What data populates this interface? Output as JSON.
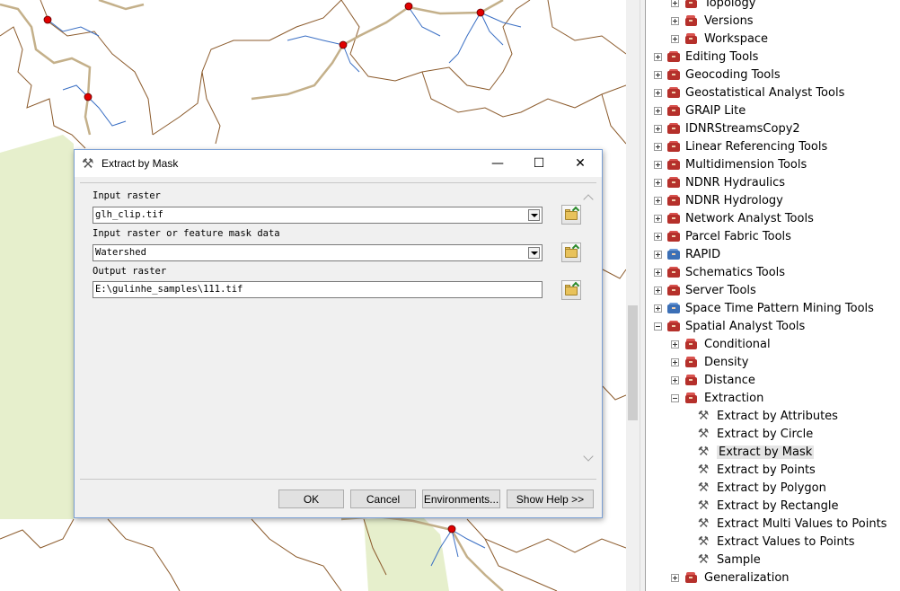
{
  "dialog": {
    "title": "Extract by Mask",
    "title_icon": "hammer-icon",
    "params": [
      {
        "label": "Input raster",
        "value": "glh_clip.tif",
        "type": "dropdown"
      },
      {
        "label": "Input raster or feature mask data",
        "value": "Watershed",
        "type": "dropdown"
      },
      {
        "label": "Output raster",
        "value": "E:\\gulinhe_samples\\111.tif",
        "type": "text"
      }
    ],
    "buttons": {
      "ok": "OK",
      "cancel": "Cancel",
      "environments": "Environments...",
      "show_help": "Show Help >>"
    },
    "window_buttons": {
      "minimize": "—",
      "maximize": "☐",
      "close": "✕"
    }
  },
  "toolbox_tree": {
    "items": [
      {
        "label": "Topology",
        "indent": 1,
        "expander": "plus",
        "icon": "toolset-icon"
      },
      {
        "label": "Versions",
        "indent": 1,
        "expander": "plus",
        "icon": "toolset-icon"
      },
      {
        "label": "Workspace",
        "indent": 1,
        "expander": "plus",
        "icon": "toolset-icon"
      },
      {
        "label": "Editing Tools",
        "indent": 0,
        "expander": "plus",
        "icon": "toolbox-icon"
      },
      {
        "label": "Geocoding Tools",
        "indent": 0,
        "expander": "plus",
        "icon": "toolbox-icon"
      },
      {
        "label": "Geostatistical Analyst Tools",
        "indent": 0,
        "expander": "plus",
        "icon": "toolbox-icon"
      },
      {
        "label": "GRAIP Lite",
        "indent": 0,
        "expander": "plus",
        "icon": "toolbox-icon"
      },
      {
        "label": "IDNRStreamsCopy2",
        "indent": 0,
        "expander": "plus",
        "icon": "toolbox-icon"
      },
      {
        "label": "Linear Referencing Tools",
        "indent": 0,
        "expander": "plus",
        "icon": "toolbox-icon"
      },
      {
        "label": "Multidimension Tools",
        "indent": 0,
        "expander": "plus",
        "icon": "toolbox-icon"
      },
      {
        "label": "NDNR Hydraulics",
        "indent": 0,
        "expander": "plus",
        "icon": "toolbox-icon"
      },
      {
        "label": "NDNR Hydrology",
        "indent": 0,
        "expander": "plus",
        "icon": "toolbox-icon"
      },
      {
        "label": "Network Analyst Tools",
        "indent": 0,
        "expander": "plus",
        "icon": "toolbox-icon"
      },
      {
        "label": "Parcel Fabric Tools",
        "indent": 0,
        "expander": "plus",
        "icon": "toolbox-icon"
      },
      {
        "label": "RAPID",
        "indent": 0,
        "expander": "plus",
        "icon": "python-toolbox-icon"
      },
      {
        "label": "Schematics Tools",
        "indent": 0,
        "expander": "plus",
        "icon": "toolbox-icon"
      },
      {
        "label": "Server Tools",
        "indent": 0,
        "expander": "plus",
        "icon": "toolbox-icon"
      },
      {
        "label": "Space Time Pattern Mining Tools",
        "indent": 0,
        "expander": "plus",
        "icon": "python-toolbox-icon"
      },
      {
        "label": "Spatial Analyst Tools",
        "indent": 0,
        "expander": "minus",
        "icon": "toolbox-icon"
      },
      {
        "label": "Conditional",
        "indent": 1,
        "expander": "plus",
        "icon": "toolset-icon"
      },
      {
        "label": "Density",
        "indent": 1,
        "expander": "plus",
        "icon": "toolset-icon"
      },
      {
        "label": "Distance",
        "indent": 1,
        "expander": "plus",
        "icon": "toolset-icon"
      },
      {
        "label": "Extraction",
        "indent": 1,
        "expander": "minus",
        "icon": "toolset-icon"
      },
      {
        "label": "Extract by Attributes",
        "indent": 2,
        "expander": "none",
        "icon": "tool-hammer-icon"
      },
      {
        "label": "Extract by Circle",
        "indent": 2,
        "expander": "none",
        "icon": "tool-hammer-icon"
      },
      {
        "label": "Extract by Mask",
        "indent": 2,
        "expander": "none",
        "icon": "tool-hammer-icon",
        "selected": true
      },
      {
        "label": "Extract by Points",
        "indent": 2,
        "expander": "none",
        "icon": "tool-hammer-icon"
      },
      {
        "label": "Extract by Polygon",
        "indent": 2,
        "expander": "none",
        "icon": "tool-hammer-icon"
      },
      {
        "label": "Extract by Rectangle",
        "indent": 2,
        "expander": "none",
        "icon": "tool-hammer-icon"
      },
      {
        "label": "Extract Multi Values to Points",
        "indent": 2,
        "expander": "none",
        "icon": "tool-hammer-icon"
      },
      {
        "label": "Extract Values to Points",
        "indent": 2,
        "expander": "none",
        "icon": "tool-hammer-icon"
      },
      {
        "label": "Sample",
        "indent": 2,
        "expander": "none",
        "icon": "tool-hammer-icon"
      },
      {
        "label": "Generalization",
        "indent": 1,
        "expander": "plus",
        "icon": "toolset-icon"
      }
    ]
  },
  "colors": {
    "boundary": "#8b5a2b",
    "river": "#3a6fc4",
    "road": "#c4b08a",
    "outlet": "#e00000",
    "land_fill": "#e6efcc"
  }
}
